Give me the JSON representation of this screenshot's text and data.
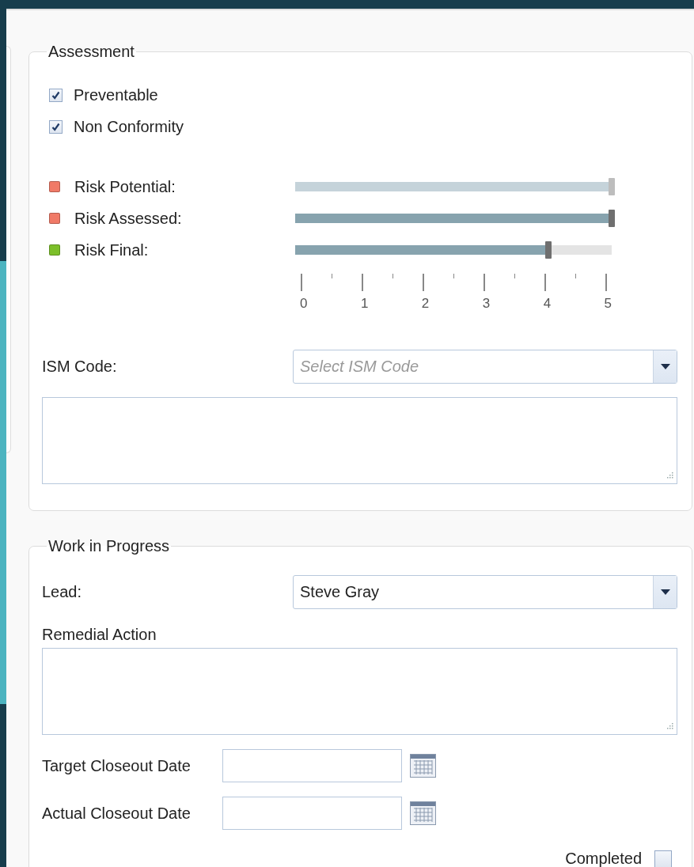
{
  "assessment": {
    "title": "Assessment",
    "checks": [
      {
        "label": "Preventable",
        "checked": true
      },
      {
        "label": "Non Conformity",
        "checked": true
      }
    ],
    "risks": [
      {
        "label": "Risk Potential:",
        "color": "#f07a67",
        "level": 1,
        "disabled": true
      },
      {
        "label": "Risk Assessed:",
        "color": "#f07a67",
        "level": 1,
        "disabled": false
      },
      {
        "label": "Risk Final:",
        "color": "#7cbf2a",
        "level": 0.8,
        "disabled": false
      }
    ],
    "scale": [
      "0",
      "1",
      "2",
      "3",
      "4",
      "5"
    ],
    "ism_code": {
      "label": "ISM Code:",
      "placeholder": "Select ISM Code"
    }
  },
  "work_in_progress": {
    "title": "Work in Progress",
    "lead": {
      "label": "Lead:",
      "value": "Steve Gray"
    },
    "remedial_action": {
      "label": "Remedial Action"
    },
    "dates": [
      {
        "label": "Target Closeout Date"
      },
      {
        "label": "Actual Closeout Date"
      }
    ],
    "completed": {
      "label": "Completed",
      "checked": false
    }
  }
}
